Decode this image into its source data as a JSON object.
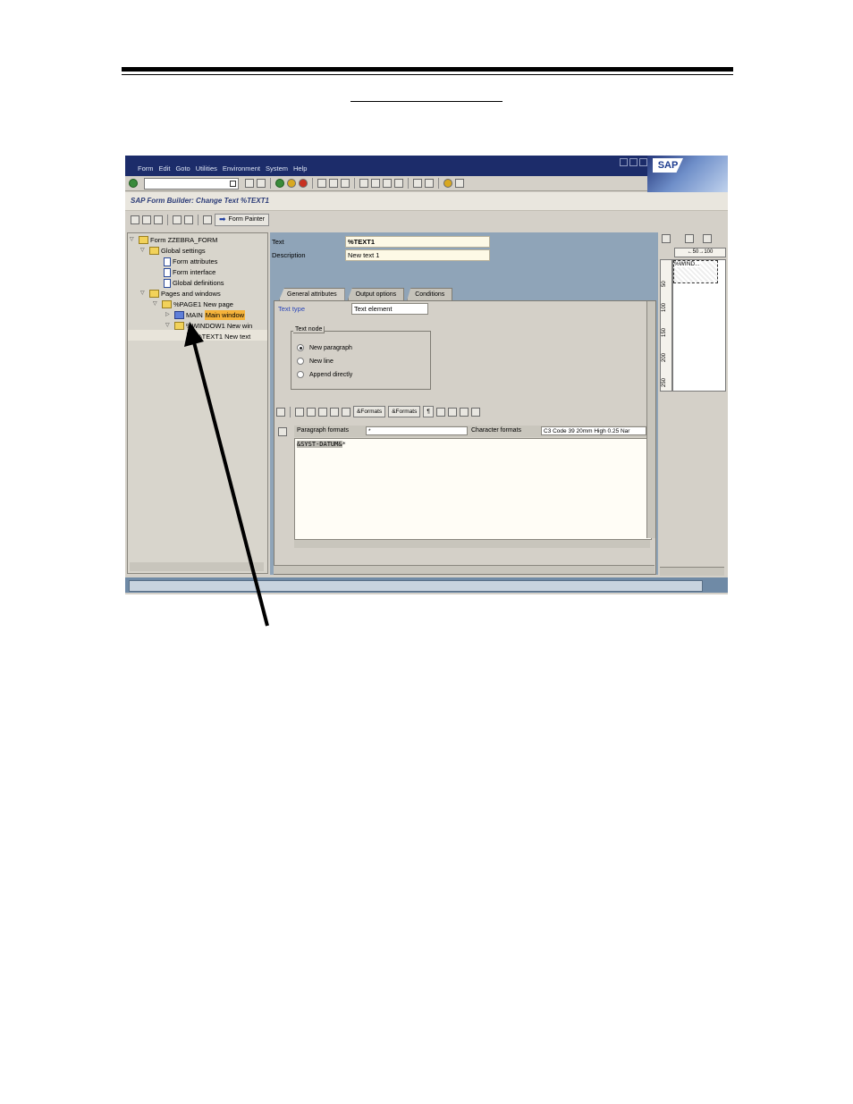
{
  "sap": {
    "menu": [
      "Form",
      "Edit",
      "Goto",
      "Utilities",
      "Environment",
      "System",
      "Help"
    ],
    "logo": "SAP",
    "app_title": "SAP Form Builder: Change Text %TEXT1",
    "toolbar": {
      "form_painter_label": "Form Painter"
    },
    "tree": {
      "root": "Form ZZEBRA_FORM",
      "global_settings": "Global settings",
      "form_attributes": "Form attributes",
      "form_interface": "Form interface",
      "global_definitions": "Global definitions",
      "pages_windows": "Pages and windows",
      "page1": "%PAGE1 New page",
      "main_name": "MAIN",
      "main_desc": "Main window",
      "window1": "%WINDOW1 New win",
      "text1": "%TEXT1 New text"
    },
    "attributes": {
      "text_label": "Text",
      "text_value": "%TEXT1",
      "description_label": "Description",
      "description_value": "New text 1"
    },
    "tabs": [
      "General attributes",
      "Output options",
      "Conditions"
    ],
    "text_type": {
      "label": "Text type",
      "value": "Text element"
    },
    "text_node": {
      "legend": "Text node",
      "options": [
        "New paragraph",
        "New line",
        "Append directly"
      ],
      "selected": "New paragraph"
    },
    "editor_toolbar": {
      "formats1": "Formats",
      "formats2": "Formats",
      "para_mark": "¶"
    },
    "formats": {
      "paragraph_label": "Paragraph formats",
      "paragraph_value": "*",
      "character_label": "Character formats",
      "character_value": "C3 Code 39 20mm High 0.25 Nar"
    },
    "editor": {
      "command": "&SYST-DATUM&",
      "cursor": "*"
    },
    "painter": {
      "ruler_top": "50",
      "ruler_top_end": "100",
      "ruler_left": [
        "50",
        "100",
        "150",
        "200",
        "250"
      ],
      "window_label": "%WIND..."
    }
  },
  "colors": {
    "title_bar": "#1c2c6a",
    "highlight": "#f4b23a",
    "detail_background": "#8fa4b8",
    "text_type_label": "#2b46b8"
  }
}
